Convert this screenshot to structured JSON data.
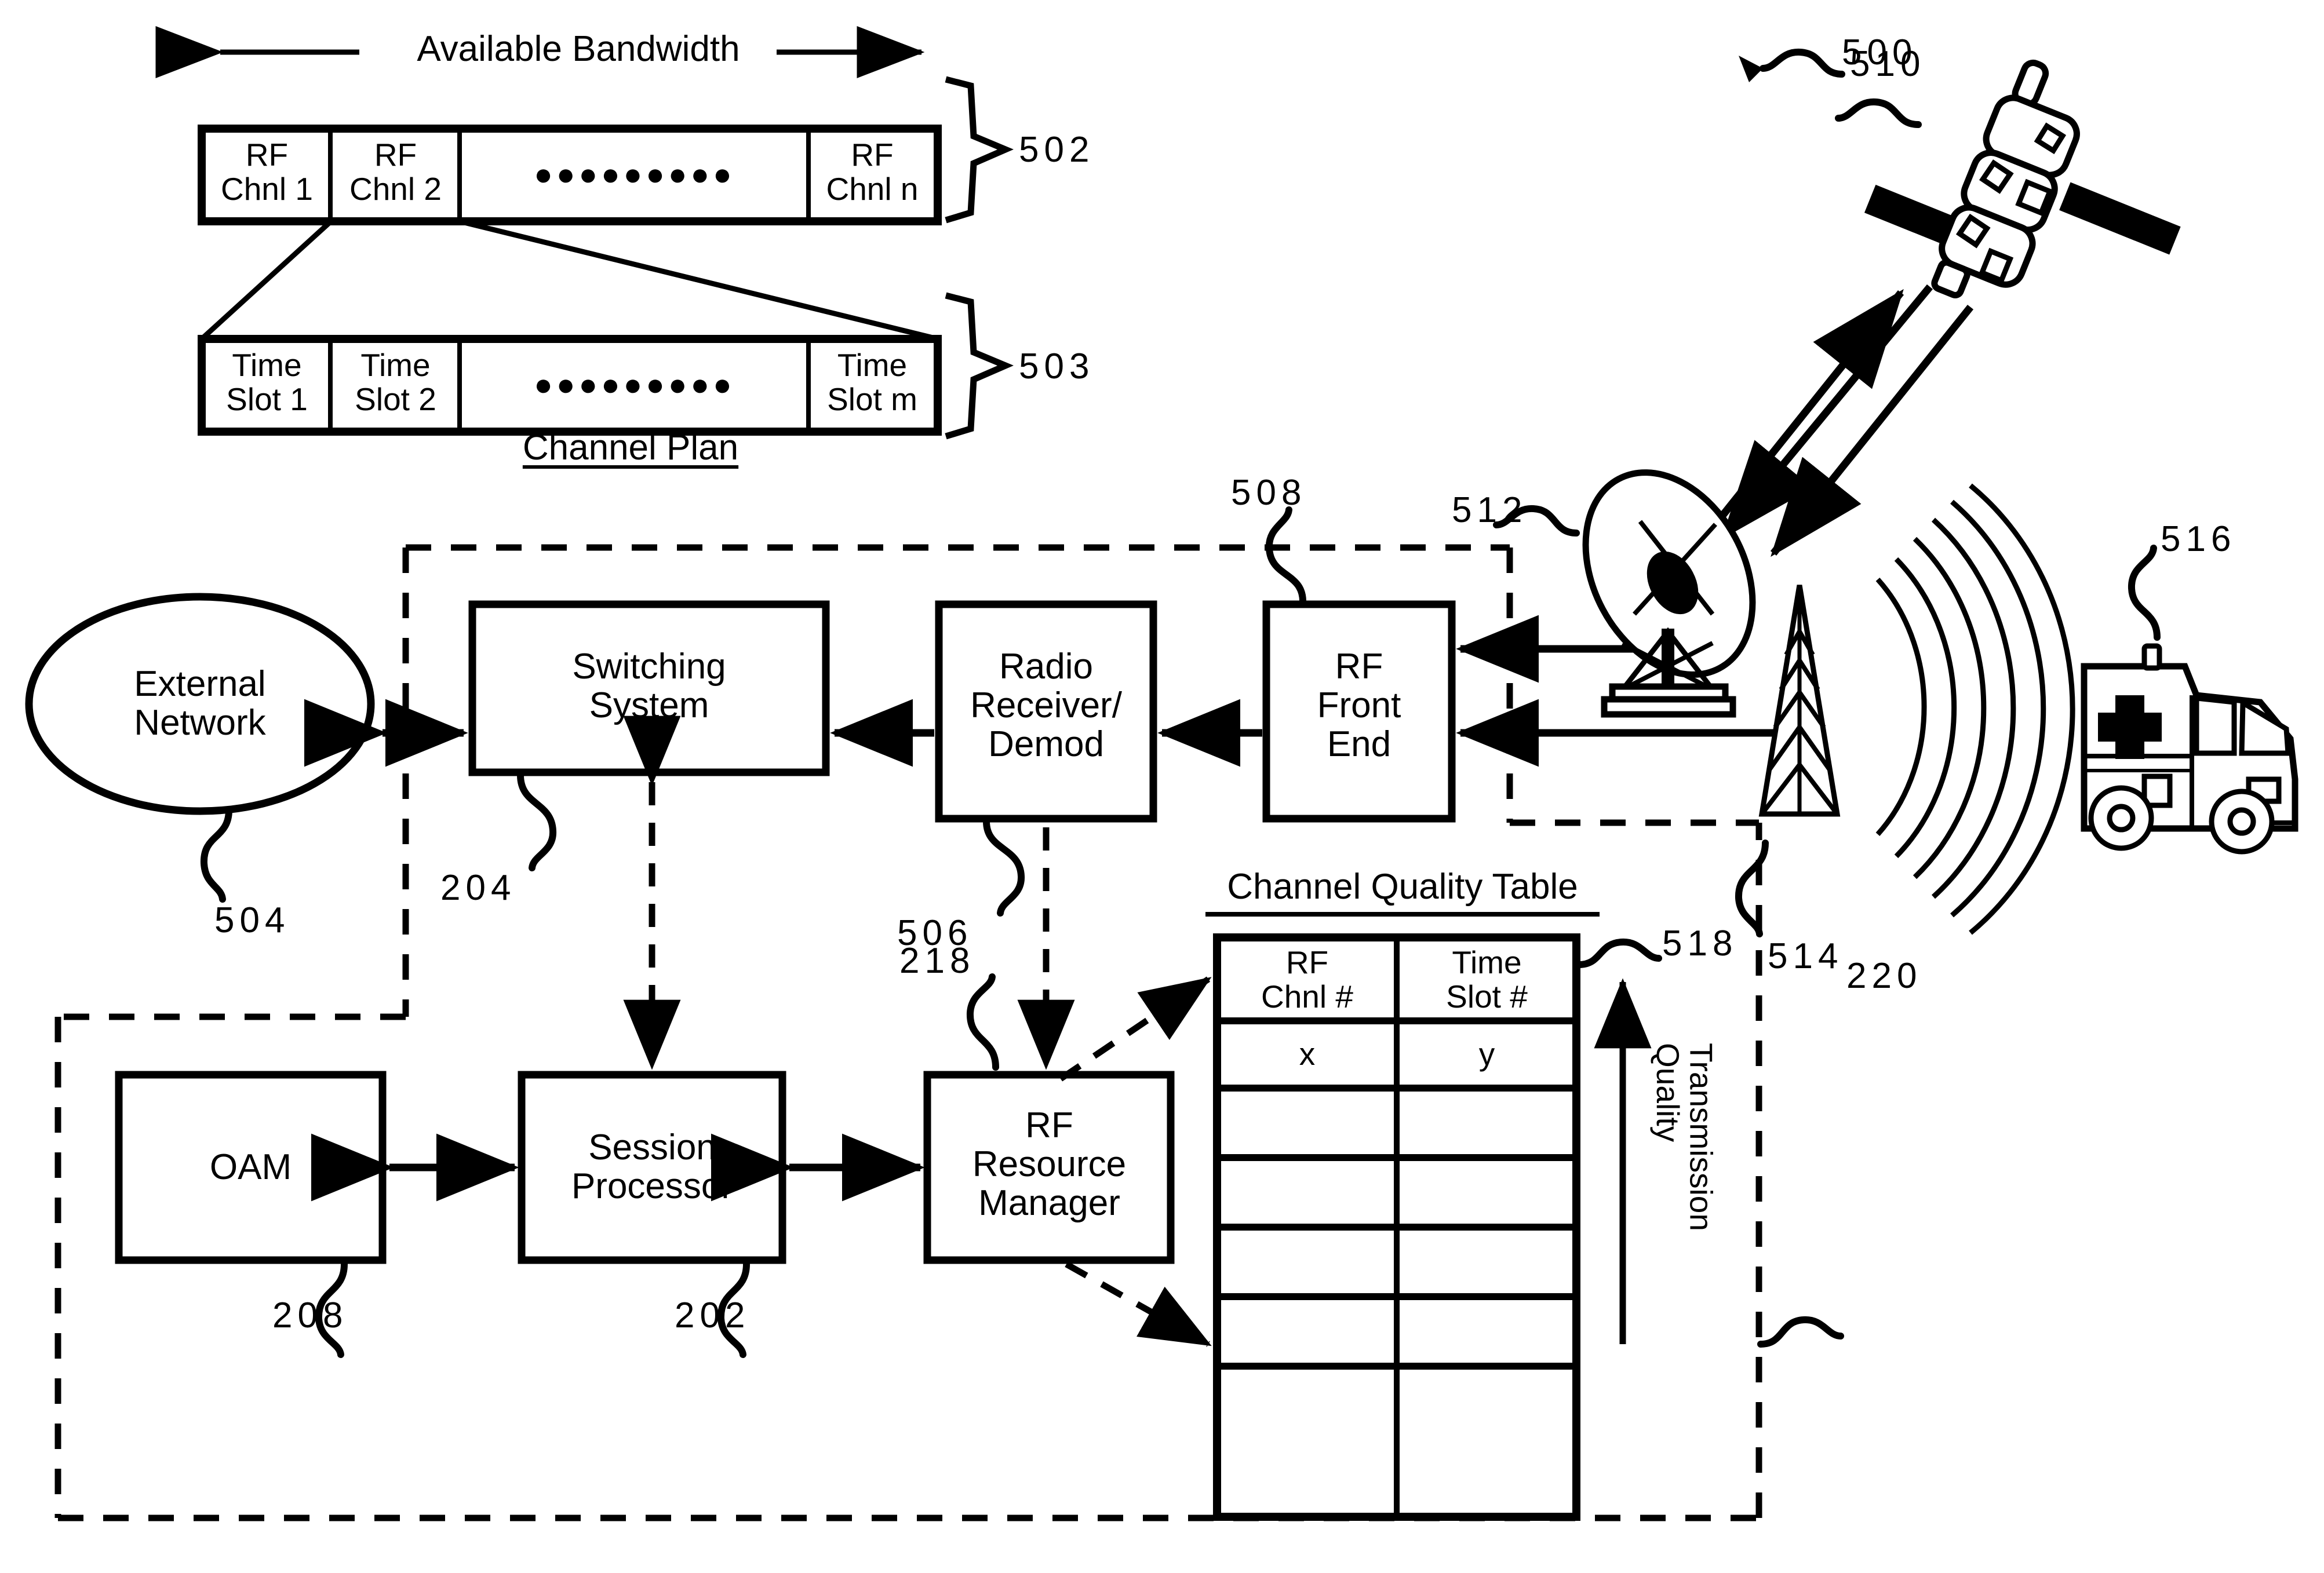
{
  "figure": {
    "channel_plan": {
      "title": "Channel Plan",
      "bandwidth_label": "Available Bandwidth",
      "rf_row": {
        "ref": "502",
        "cells": [
          "RF\nChnl 1",
          "RF\nChnl 2",
          "●●●●●●●●●",
          "RF\nChnl n"
        ]
      },
      "ts_row": {
        "ref": "503",
        "cells": [
          "Time\nSlot 1",
          "Time\nSlot 2",
          "●●●●●●●●●",
          "Time\nSlot m"
        ]
      }
    },
    "blocks": {
      "external_network": {
        "label": "External\nNetwork",
        "ref": "504"
      },
      "switching_system": {
        "label": "Switching\nSystem",
        "ref": "204"
      },
      "radio_receiver": {
        "label": "Radio\nReceiver/\nDemod",
        "ref": "506"
      },
      "rf_front_end": {
        "label": "RF\nFront\nEnd",
        "ref": "508"
      },
      "oam": {
        "label": "OAM",
        "ref": "208"
      },
      "session_processor": {
        "label": "Session\nProcessor",
        "ref": "202"
      },
      "rf_resource_manager": {
        "label": "RF\nResource\nManager",
        "ref": "218"
      }
    },
    "objects": {
      "system_ref": "500",
      "satellite": {
        "ref": "510",
        "name": "satellite-icon"
      },
      "satellite_dish": {
        "ref": "512",
        "name": "satellite-dish-icon"
      },
      "antenna_tower": {
        "ref": "514",
        "name": "antenna-tower-icon"
      },
      "ambulance": {
        "ref": "516",
        "name": "ambulance-icon"
      },
      "core_network_boundary_ref": "220"
    },
    "channel_quality_table": {
      "title": "Channel Quality Table",
      "ref": "518",
      "columns": [
        "RF\nChnl #",
        "Time\nSlot #"
      ],
      "rows": [
        [
          "x",
          "y"
        ],
        [
          "",
          ""
        ],
        [
          "",
          ""
        ],
        [
          "",
          ""
        ],
        [
          "",
          ""
        ],
        [
          "",
          ""
        ]
      ],
      "axis_label": "Transmission\nQuality"
    }
  }
}
